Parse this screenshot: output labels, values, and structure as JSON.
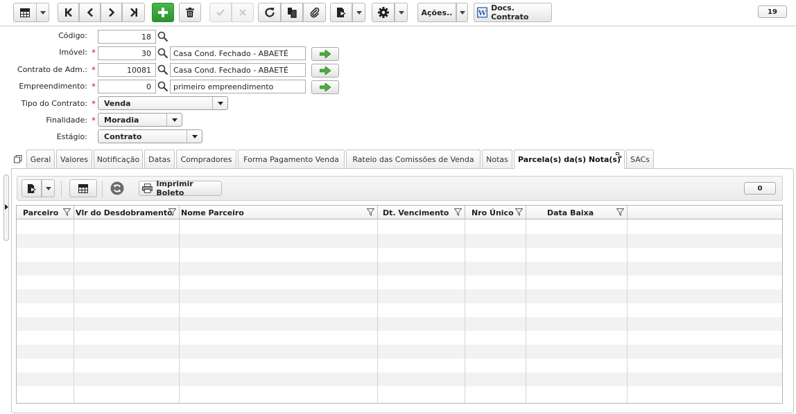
{
  "toolbar": {
    "record_counter": "19",
    "actions_label": "Ações..",
    "docs_label": "Docs. Contrato"
  },
  "form": {
    "codigo": {
      "label": "Código:",
      "value": "18"
    },
    "imovel": {
      "label": "Imóvel:",
      "value": "30",
      "description": "Casa Cond. Fechado - ABAETÉ",
      "required": "*"
    },
    "contrato_adm": {
      "label": "Contrato de Adm.:",
      "value": "10081",
      "description": "Casa Cond. Fechado - ABAETÉ",
      "required": "*"
    },
    "empreendimento": {
      "label": "Empreendimento:",
      "value": "0",
      "description": "primeiro empreendimento",
      "required": "*"
    },
    "tipo_contrato": {
      "label": "Tipo do Contrato:",
      "value": "Venda",
      "required": "*"
    },
    "finalidade": {
      "label": "Finalidade:",
      "value": "Moradia",
      "required": "*"
    },
    "estagio": {
      "label": "Estágio:",
      "value": "Contrato"
    }
  },
  "tabs": [
    {
      "label": "Geral"
    },
    {
      "label": "Valores"
    },
    {
      "label": "Notificação"
    },
    {
      "label": "Datas"
    },
    {
      "label": "Compradores"
    },
    {
      "label": "Forma Pagamento Venda"
    },
    {
      "label": "Rateio das Comissões de Venda"
    },
    {
      "label": "Notas"
    },
    {
      "label": "Parcela(s) da(s) Nota(s)"
    },
    {
      "label": "SACs"
    }
  ],
  "active_tab": "Parcela(s) da(s) Nota(s)",
  "inner_toolbar": {
    "print_label": "Imprimir Boleto",
    "counter": "0"
  },
  "grid": {
    "columns": [
      {
        "label": "Parceiro"
      },
      {
        "label": "Vlr do Desdobramento"
      },
      {
        "label": "Nome Parceiro"
      },
      {
        "label": "Dt. Vencimento"
      },
      {
        "label": "Nro Único"
      },
      {
        "label": "Data Baixa"
      }
    ]
  },
  "colors": {
    "accent_green": "#2b9330",
    "required_red": "#d32020",
    "border": "#b5b5b5"
  }
}
